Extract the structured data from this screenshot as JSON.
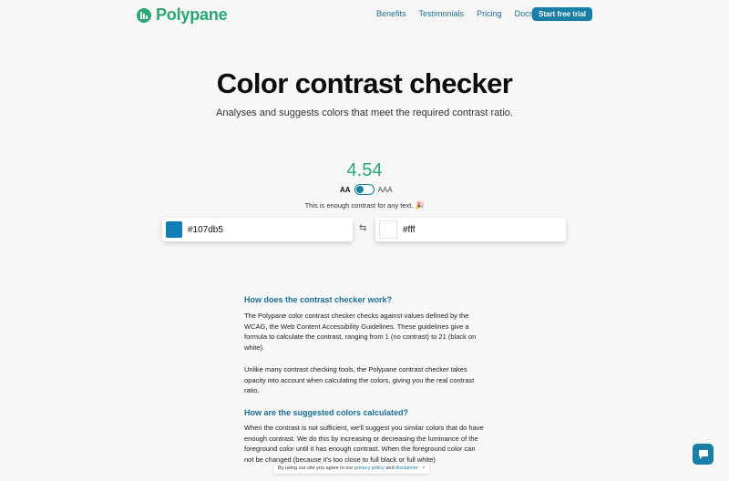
{
  "nav": {
    "brand": "Polypane",
    "links": [
      "Benefits",
      "Testimonials",
      "Pricing",
      "Docs"
    ],
    "cta": "Start free trial",
    "brand_color": "#2aa673"
  },
  "hero": {
    "title": "Color contrast checker",
    "subtitle": "Analyses and suggests colors that meet the required contrast ratio."
  },
  "checker": {
    "ratio": "4.54",
    "level_aa": "AA",
    "level_aaa": "AAA",
    "message": "This is enough contrast for any text.",
    "emoji": "🎉",
    "foreground": "#107db5",
    "background": "#fff",
    "swap_glyph": "⇆"
  },
  "article": {
    "q1": "How does the contrast checker work?",
    "p1": "The Polypane color contrast checker checks against values defined by the WCAG, the Web Content Accessibility Guidelines. These guidelines give a formula to calculate the contrast, ranging from 1 (no contrast) to 21 (black on white).",
    "p2": "Unlike many contrast checking tools, the Polypane contrast checker takes opacity into account when calculating the colors, giving you the real contrast ratio.",
    "q2": "How are the suggested colors calculated?",
    "p3": "When the contrast is not sufficient, we'll suggest you similar colors that do have enough contrast. We do this by increasing or decreasing the luminance of the foreground color until it has enough contrast. When the foreground color can not be changed (because it's too close to full black or full white)"
  },
  "cookie": {
    "text": "By using our site you agree to our",
    "privacy": "privacy policy",
    "and": "and",
    "disclaimer": "disclaimer",
    "close": "×"
  },
  "colors": {
    "accent": "#1a7fa6",
    "ratio_green": "#2aa673"
  }
}
